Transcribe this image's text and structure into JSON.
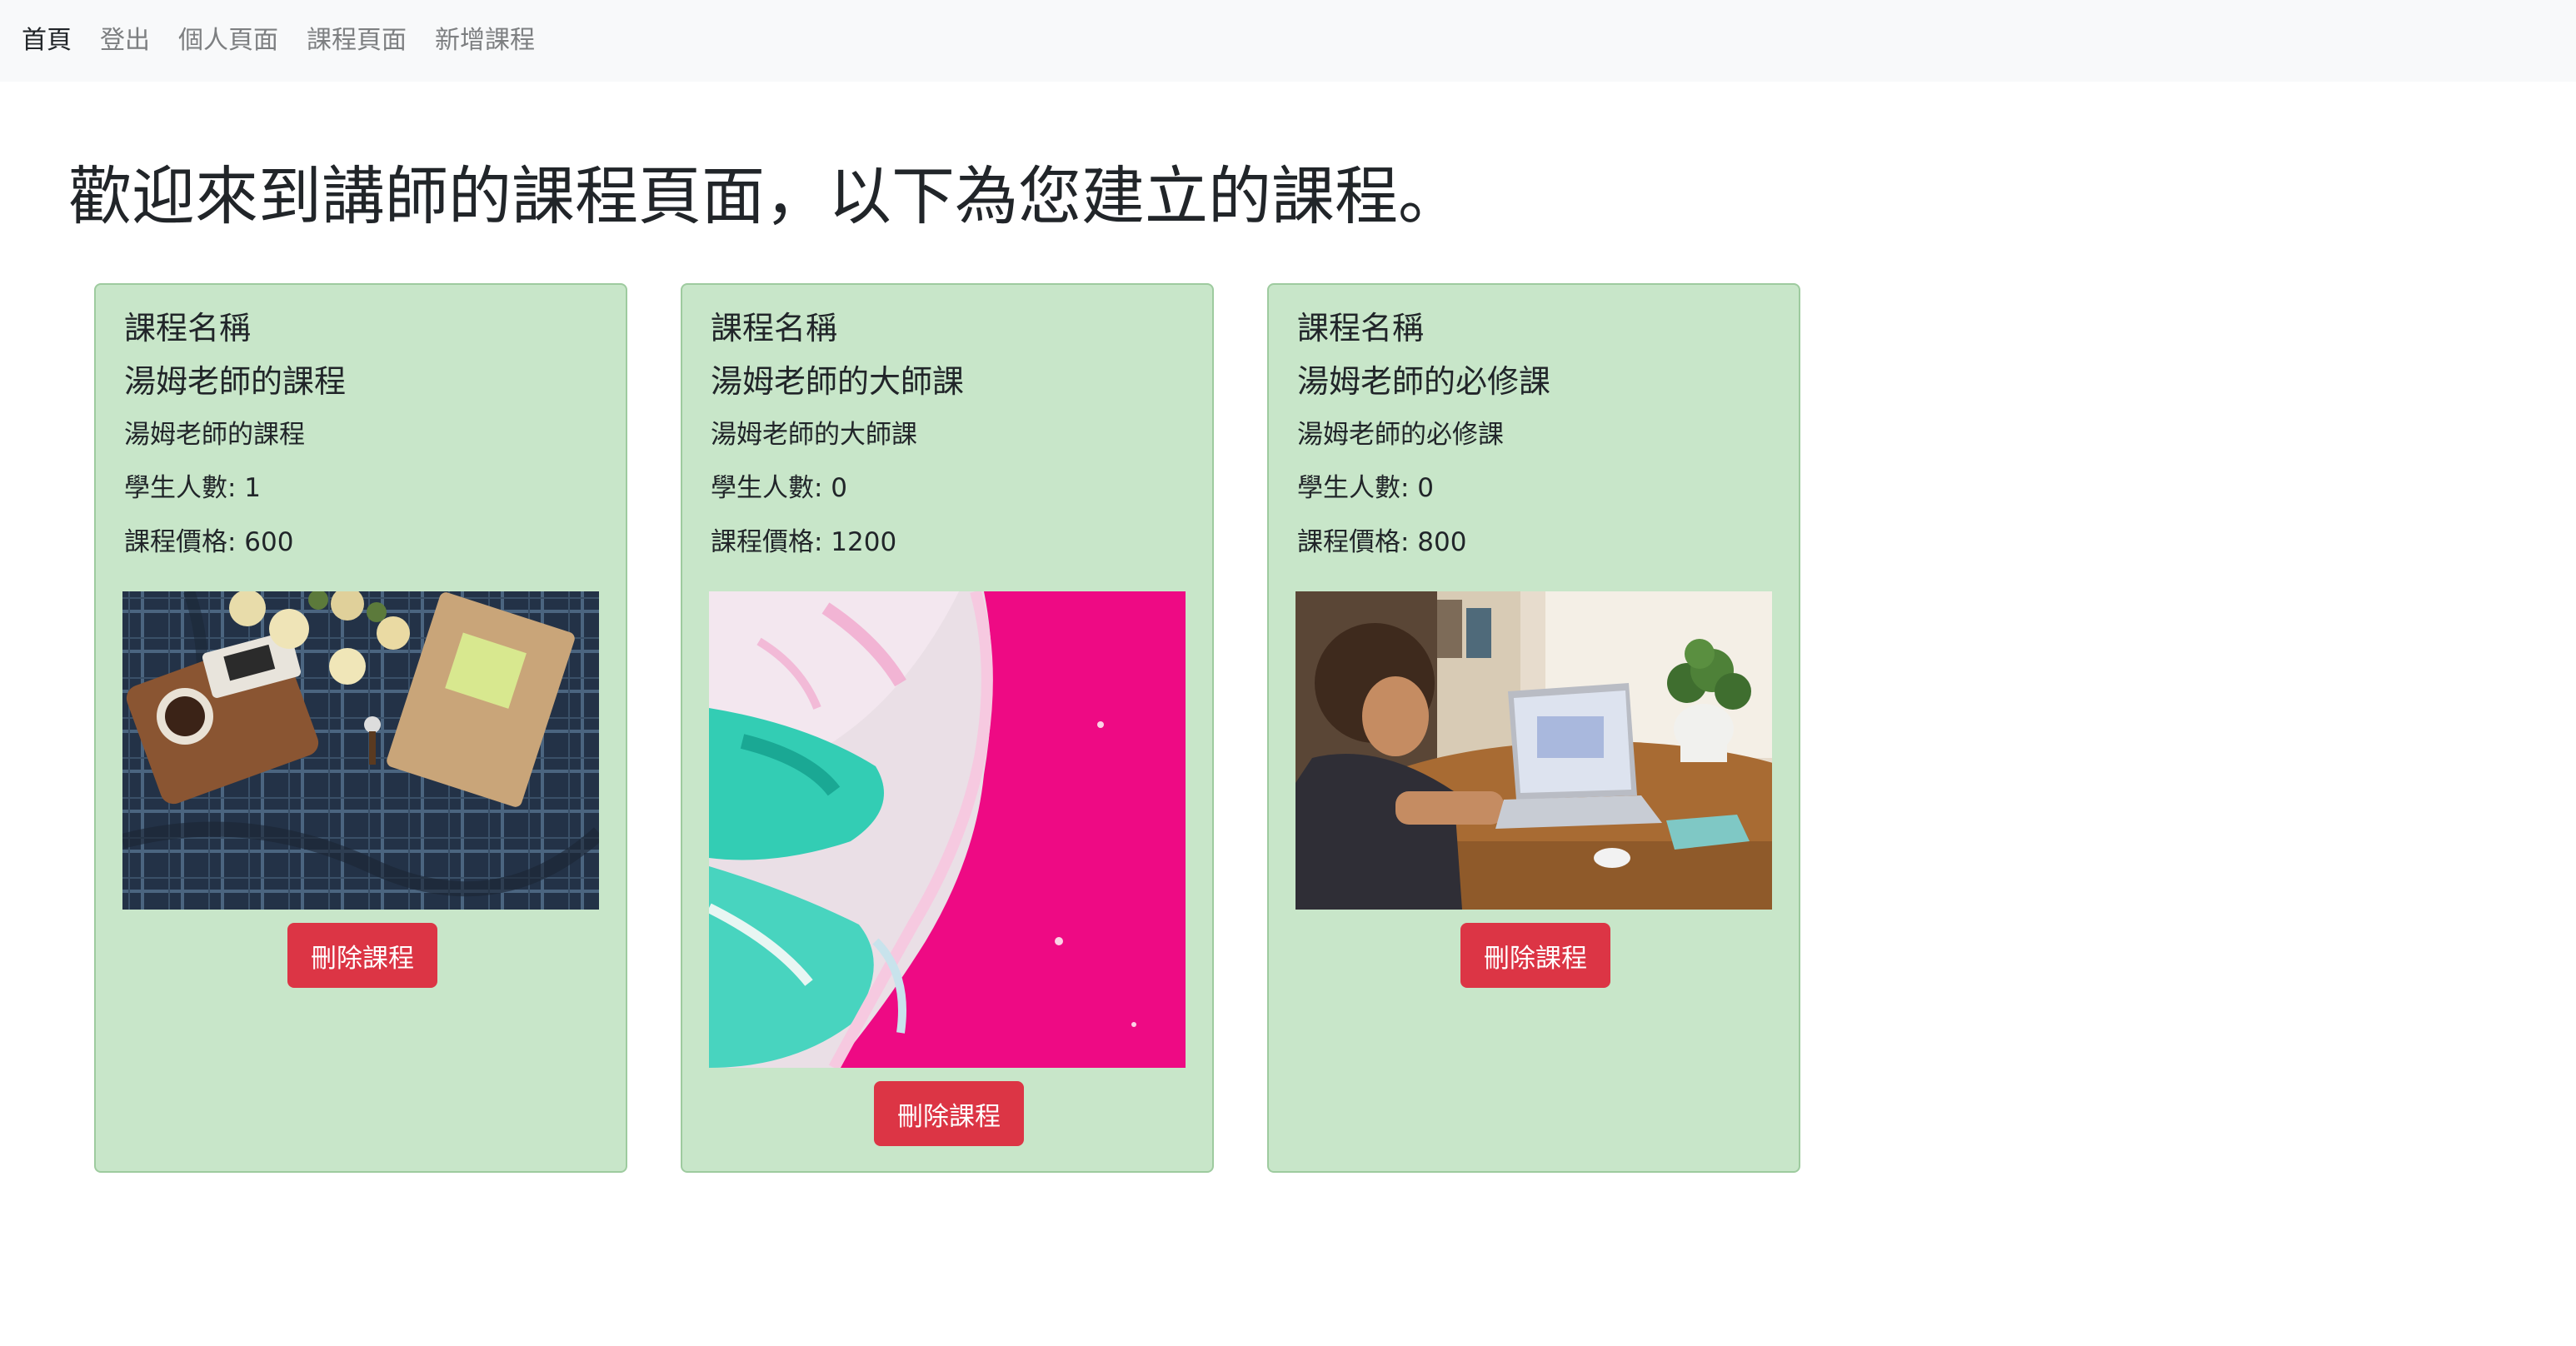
{
  "nav": {
    "items": [
      {
        "label": "首頁",
        "active": true
      },
      {
        "label": "登出",
        "active": false
      },
      {
        "label": "個人頁面",
        "active": false
      },
      {
        "label": "課程頁面",
        "active": false
      },
      {
        "label": "新增課程",
        "active": false
      }
    ]
  },
  "page": {
    "heading": "歡迎來到講師的課程頁面，以下為您建立的課程。"
  },
  "courses": [
    {
      "label": "課程名稱",
      "title": "湯姆老師的課程",
      "description": "湯姆老師的課程",
      "students": "學生人數: 1",
      "price": "課程價格: 600",
      "image": "flatlay-notebook-flowers-coffee",
      "delete_label": "刪除課程"
    },
    {
      "label": "課程名稱",
      "title": "湯姆老師的大師課",
      "description": "湯姆老師的大師課",
      "students": "學生人數: 0",
      "price": "課程價格: 1200",
      "image": "abstract-fluid-art-pink-teal",
      "delete_label": "刪除課程"
    },
    {
      "label": "課程名稱",
      "title": "湯姆老師的必修課",
      "description": "湯姆老師的必修課",
      "students": "學生人數: 0",
      "price": "課程價格: 800",
      "image": "woman-working-on-laptop",
      "delete_label": "刪除課程"
    }
  ],
  "colors": {
    "card_bg": "#c8e6c9",
    "card_border": "#9ecb9f",
    "danger": "#dc3545",
    "navbar_bg": "#f8f9fa"
  }
}
